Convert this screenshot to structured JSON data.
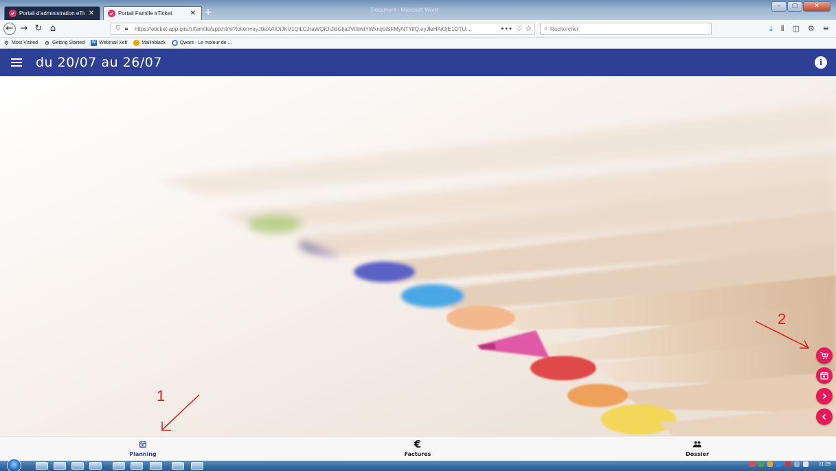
{
  "browser": {
    "tabs": [
      {
        "label": "Portail d'administration eTicket",
        "active": false
      },
      {
        "label": "Portail Famille eTicket",
        "active": true
      }
    ],
    "background_window_title": "Document - Microsoft Word",
    "url": "https://eticket-app.qiis.fr/famille/app.html?token=eyJ0eXAiOiJKV1QiLCJraWQiOiJldGlja2V0IiwiYWxnIjoiSFMyNTYifQ.eyJleHAiOjE1OTU...",
    "url_actions": [
      "•••",
      "♡",
      "☆"
    ],
    "search_placeholder": "Rechercher",
    "bookmarks": [
      {
        "label": "Most Visited",
        "icon": "gear-icon"
      },
      {
        "label": "Getting Started",
        "icon": "globe-icon"
      },
      {
        "label": "Webmail Xefi",
        "icon": "webmail-icon"
      },
      {
        "label": "Mailinblack",
        "icon": "mailinblack-icon"
      },
      {
        "label": "Qwant - Le moteur de ...",
        "icon": "qwant-icon"
      }
    ]
  },
  "app": {
    "title": "du 20/07 au 26/07",
    "colors": {
      "primary": "#2e3f96",
      "accent": "#e6195a"
    },
    "bottom_nav": [
      {
        "label": "Planning",
        "icon": "calendar-icon",
        "active": true
      },
      {
        "label": "Factures",
        "icon": "euro-icon",
        "active": false
      },
      {
        "label": "Dossier",
        "icon": "group-icon",
        "active": false
      }
    ],
    "fabs": [
      {
        "name": "cart-button",
        "icon": "cart-icon"
      },
      {
        "name": "calendar-button",
        "icon": "calendar-icon"
      },
      {
        "name": "next-button",
        "icon": "chevron-right-icon"
      },
      {
        "name": "previous-button",
        "icon": "chevron-left-icon"
      }
    ]
  },
  "annotations": {
    "one": "1",
    "two": "2"
  },
  "taskbar": {
    "clock": "11:29"
  }
}
